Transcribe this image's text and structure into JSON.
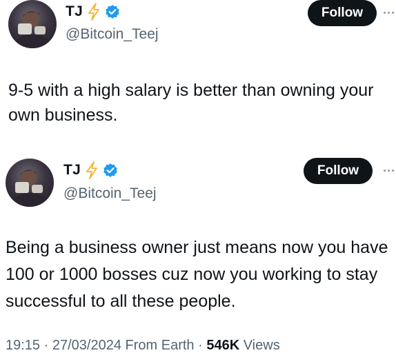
{
  "tweets": [
    {
      "author": {
        "name": "TJ",
        "handle": "@Bitcoin_Teej"
      },
      "follow_label": "Follow",
      "text": "9-5 with a high salary is better than owning your own business."
    },
    {
      "author": {
        "name": "TJ",
        "handle": "@Bitcoin_Teej"
      },
      "follow_label": "Follow",
      "text": "Being a business owner just means now you have 100 or 1000 bosses cuz now you working to stay successful to all these people.",
      "meta": {
        "time": "19:15",
        "date": "27/03/2024",
        "source": "From Earth",
        "views_count": "546K",
        "views_label": "Views"
      }
    }
  ],
  "icons": {
    "bolt": "lightning-bolt-icon",
    "verified": "verified-badge-icon",
    "more": "more-options-icon"
  },
  "colors": {
    "bolt_stroke": "#f7b32b",
    "verified_blue": "#1d9bf0",
    "follow_bg": "#0f1419",
    "secondary_text": "#536471"
  }
}
